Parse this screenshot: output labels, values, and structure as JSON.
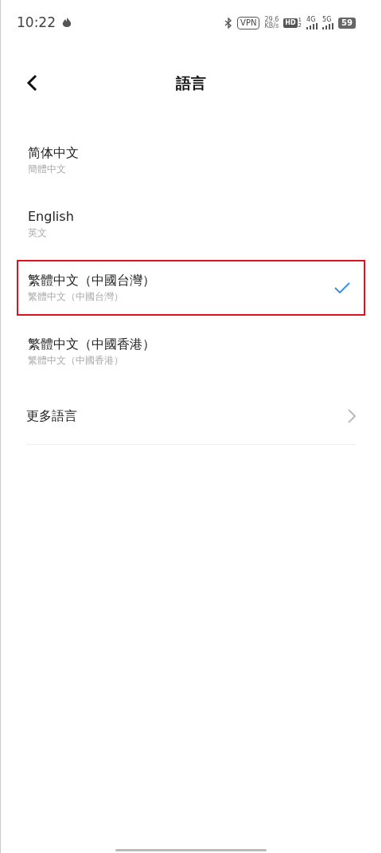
{
  "status_bar": {
    "time": "10:22",
    "vpn": "VPN",
    "speed": "29.6",
    "speed_unit": "KB/s",
    "hd": "HD",
    "hd_sup": "1",
    "hd_sub": "2",
    "net1": "4G",
    "net2": "5G",
    "battery": "59"
  },
  "header": {
    "title": "語言"
  },
  "languages": [
    {
      "title": "简体中文",
      "subtitle": "簡體中文",
      "selected": false
    },
    {
      "title": "English",
      "subtitle": "英文",
      "selected": false
    },
    {
      "title": "繁體中文（中國台灣）",
      "subtitle": "繁體中文（中國台灣）",
      "selected": true
    },
    {
      "title": "繁體中文（中國香港）",
      "subtitle": "繁體中文（中國香港）",
      "selected": false
    }
  ],
  "more": {
    "label": "更多語言"
  }
}
